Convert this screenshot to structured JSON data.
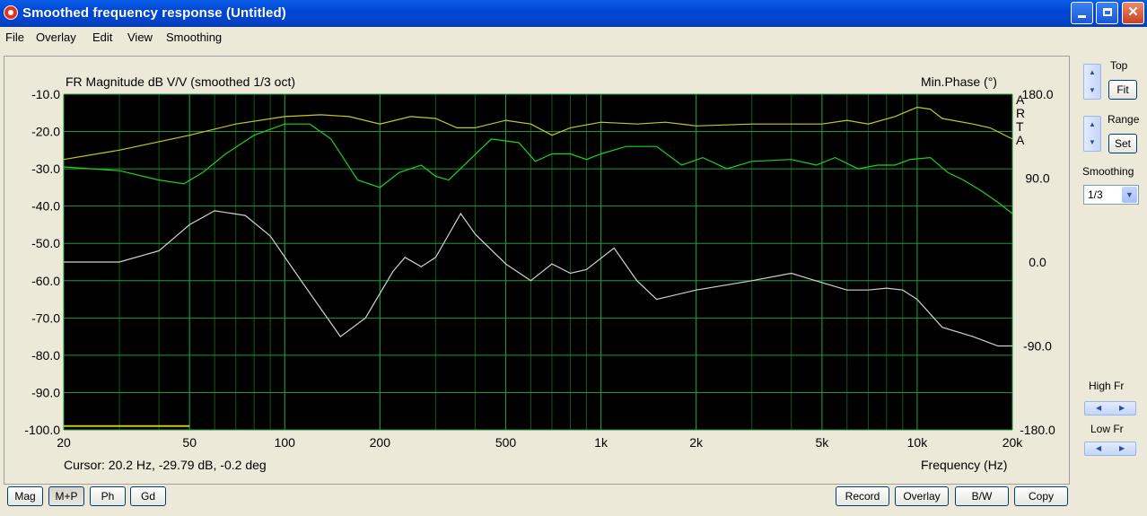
{
  "window": {
    "title": "Smoothed frequency response (Untitled)"
  },
  "menu": [
    "File",
    "Overlay",
    "Edit",
    "View",
    "Smoothing"
  ],
  "plot": {
    "left_title": "FR Magnitude dB V/V (smoothed 1/3 oct)",
    "right_title": "Min.Phase (°)",
    "brand_letters": [
      "A",
      "R",
      "T",
      "A"
    ],
    "cursor_text": "Cursor: 20.2 Hz, -29.79 dB, -0.2 deg",
    "x_axis_label": "Frequency (Hz)"
  },
  "chart_data": {
    "type": "line",
    "x_scale": "log",
    "xlim": [
      20,
      20000
    ],
    "ylim": [
      -100,
      -10
    ],
    "ylim_right": [
      -180,
      180
    ],
    "grid": true,
    "x_ticks": [
      {
        "v": 20,
        "label": "20"
      },
      {
        "v": 50,
        "label": "50"
      },
      {
        "v": 100,
        "label": "100"
      },
      {
        "v": 200,
        "label": "200"
      },
      {
        "v": 500,
        "label": "500"
      },
      {
        "v": 1000,
        "label": "1k"
      },
      {
        "v": 2000,
        "label": "2k"
      },
      {
        "v": 5000,
        "label": "5k"
      },
      {
        "v": 10000,
        "label": "10k"
      },
      {
        "v": 20000,
        "label": "20k"
      }
    ],
    "y_ticks": [
      "-10.0",
      "-20.0",
      "-30.0",
      "-40.0",
      "-50.0",
      "-60.0",
      "-70.0",
      "-80.0",
      "-90.0",
      "-100.0"
    ],
    "y_ticks_right": [
      {
        "v": 180,
        "label": "180.0"
      },
      {
        "v": 90,
        "label": "90.0"
      },
      {
        "v": 0,
        "label": "0.0"
      },
      {
        "v": -90,
        "label": "-90.0"
      },
      {
        "v": -180,
        "label": "-180.0"
      }
    ],
    "series": [
      {
        "color": "#c8c81e",
        "axis": "left",
        "points": [
          [
            20,
            -27.5
          ],
          [
            30,
            -25
          ],
          [
            50,
            -21
          ],
          [
            70,
            -18
          ],
          [
            100,
            -16
          ],
          [
            130,
            -15.5
          ],
          [
            160,
            -16
          ],
          [
            200,
            -18
          ],
          [
            250,
            -16
          ],
          [
            300,
            -16.5
          ],
          [
            350,
            -19
          ],
          [
            400,
            -19
          ],
          [
            500,
            -17
          ],
          [
            600,
            -18
          ],
          [
            700,
            -21
          ],
          [
            800,
            -19
          ],
          [
            1000,
            -17.5
          ],
          [
            1300,
            -18
          ],
          [
            1600,
            -17.5
          ],
          [
            2000,
            -18.5
          ],
          [
            3000,
            -18
          ],
          [
            4000,
            -18
          ],
          [
            5000,
            -18
          ],
          [
            6000,
            -17
          ],
          [
            7000,
            -18
          ],
          [
            8500,
            -16
          ],
          [
            10000,
            -13.5
          ],
          [
            11000,
            -14
          ],
          [
            12000,
            -16.5
          ],
          [
            15000,
            -18
          ],
          [
            17000,
            -19
          ],
          [
            20000,
            -22
          ]
        ]
      },
      {
        "color": "#1ed21e",
        "axis": "left",
        "points": [
          [
            20,
            -29.5
          ],
          [
            30,
            -30.5
          ],
          [
            40,
            -33
          ],
          [
            48,
            -34
          ],
          [
            55,
            -31
          ],
          [
            65,
            -26
          ],
          [
            80,
            -21
          ],
          [
            100,
            -18
          ],
          [
            120,
            -18
          ],
          [
            140,
            -22
          ],
          [
            170,
            -33
          ],
          [
            200,
            -35
          ],
          [
            230,
            -31
          ],
          [
            270,
            -29
          ],
          [
            300,
            -32
          ],
          [
            330,
            -33
          ],
          [
            380,
            -28
          ],
          [
            450,
            -22
          ],
          [
            550,
            -23
          ],
          [
            620,
            -28
          ],
          [
            700,
            -26
          ],
          [
            800,
            -26
          ],
          [
            900,
            -27.5
          ],
          [
            1000,
            -26
          ],
          [
            1200,
            -24
          ],
          [
            1500,
            -24
          ],
          [
            1800,
            -29
          ],
          [
            2100,
            -27
          ],
          [
            2500,
            -30
          ],
          [
            3000,
            -28
          ],
          [
            4000,
            -27.5
          ],
          [
            4800,
            -29
          ],
          [
            5500,
            -27
          ],
          [
            6500,
            -30
          ],
          [
            7500,
            -29
          ],
          [
            8500,
            -29
          ],
          [
            9500,
            -27.5
          ],
          [
            11000,
            -27
          ],
          [
            12500,
            -31
          ],
          [
            14000,
            -33
          ],
          [
            16000,
            -36
          ],
          [
            18000,
            -39
          ],
          [
            20000,
            -42
          ]
        ]
      },
      {
        "color": "#d0d0d0",
        "axis": "right",
        "points": [
          [
            20,
            0
          ],
          [
            30,
            0
          ],
          [
            40,
            12
          ],
          [
            50,
            40
          ],
          [
            60,
            55
          ],
          [
            75,
            50
          ],
          [
            90,
            28
          ],
          [
            110,
            -15
          ],
          [
            150,
            -80
          ],
          [
            180,
            -60
          ],
          [
            220,
            -10
          ],
          [
            240,
            5
          ],
          [
            270,
            -5
          ],
          [
            300,
            5
          ],
          [
            360,
            52
          ],
          [
            400,
            30
          ],
          [
            500,
            -2
          ],
          [
            600,
            -20
          ],
          [
            700,
            -2
          ],
          [
            800,
            -12
          ],
          [
            900,
            -8
          ],
          [
            1100,
            15
          ],
          [
            1300,
            -20
          ],
          [
            1500,
            -40
          ],
          [
            2000,
            -30
          ],
          [
            3000,
            -20
          ],
          [
            4000,
            -12
          ],
          [
            5000,
            -22
          ],
          [
            6000,
            -30
          ],
          [
            7000,
            -30
          ],
          [
            8000,
            -28
          ],
          [
            9000,
            -30
          ],
          [
            10000,
            -40
          ],
          [
            12000,
            -70
          ],
          [
            15000,
            -80
          ],
          [
            18000,
            -90
          ],
          [
            20000,
            -90
          ]
        ]
      },
      {
        "color": "#c8c81e",
        "axis": "left",
        "points": [
          [
            20,
            -99
          ],
          [
            50,
            -99
          ]
        ]
      }
    ]
  },
  "side_panel": {
    "top_label": "Top",
    "fit_label": "Fit",
    "range_label": "Range",
    "set_label": "Set",
    "smoothing_label": "Smoothing",
    "smoothing_value": "1/3",
    "high_fr_label": "High Fr",
    "low_fr_label": "Low Fr"
  },
  "bottom_buttons": {
    "mag": "Mag",
    "mp": "M+P",
    "ph": "Ph",
    "gd": "Gd",
    "record": "Record",
    "overlay": "Overlay",
    "bw": "B/W",
    "copy": "Copy"
  }
}
